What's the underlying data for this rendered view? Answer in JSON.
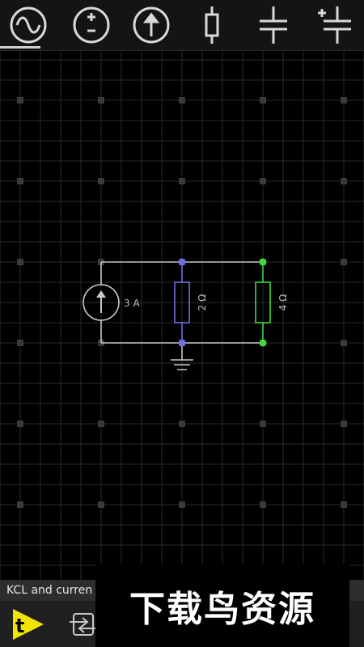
{
  "toolbar": {
    "tools": [
      {
        "icon": "ac-source-icon",
        "selected": true
      },
      {
        "icon": "dc-voltage-source-icon",
        "selected": false
      },
      {
        "icon": "current-source-icon",
        "selected": false
      },
      {
        "icon": "resistor-icon",
        "selected": false
      },
      {
        "icon": "capacitor-icon",
        "selected": false
      },
      {
        "icon": "polarized-capacitor-icon",
        "selected": false
      }
    ]
  },
  "circuit": {
    "current_source_label": "3 A",
    "resistor1_label": "2 Ω",
    "resistor2_label": "4 Ω",
    "colors": {
      "wire": "#c8c8c8",
      "resistor1": "#6f6fe0",
      "resistor2": "#3fd83f",
      "grid": "#2a2a2a"
    }
  },
  "status": {
    "text": "KCL and curren"
  },
  "bottom": {
    "app_icon": "app-logo-icon",
    "swap_icon": "swap-icon"
  },
  "watermark": {
    "text": "下载鸟资源"
  }
}
